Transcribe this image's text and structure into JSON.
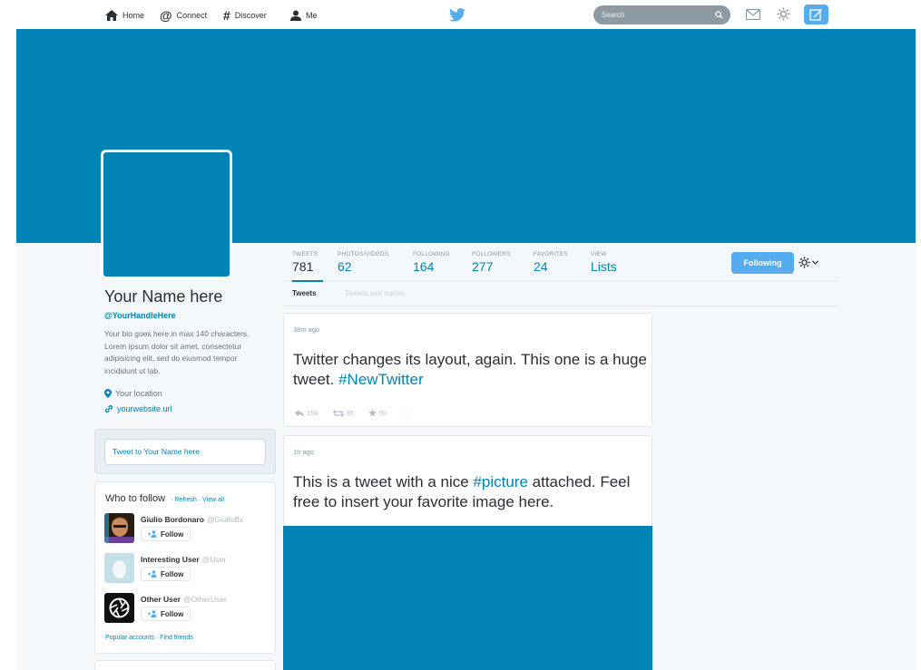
{
  "nav": {
    "home": "Home",
    "connect": "Connect",
    "discover": "Discover",
    "me": "Me",
    "search_placeholder": "Search"
  },
  "profile": {
    "name": "Your Name here",
    "handle": "@YourHandleHere",
    "bio": "Your bio goes here in max 140 characters. Lorem ipsum dolor sit amet, consectetur adipisicing elit, sed do eiusmod tempor incididunt ut lab.",
    "location": "Your location",
    "website": "yourwebsite.url"
  },
  "tweet_box": {
    "placeholder": "Tweet to Your Name here"
  },
  "who_to_follow": {
    "title": "Who to follow",
    "links": "· Refresh · View all",
    "users": [
      {
        "name": "Giulio Bordonaro",
        "handle": "@GiulioBx",
        "follow": "Follow"
      },
      {
        "name": "Interesting User",
        "handle": "@User",
        "follow": "Follow"
      },
      {
        "name": "Other User",
        "handle": "@OtherUser",
        "follow": "Follow"
      }
    ],
    "footer": "Popular accounts · Find friends"
  },
  "stats": [
    {
      "label": "TWEETS",
      "value": "781"
    },
    {
      "label": "PHOTOS/VIDEOS",
      "value": "62"
    },
    {
      "label": "FOLLOWING",
      "value": "164"
    },
    {
      "label": "FOLLOWERS",
      "value": "277"
    },
    {
      "label": "FAVORITES",
      "value": "24"
    },
    {
      "label": "VIEW",
      "value": "Lists"
    }
  ],
  "following_button": "Following",
  "tabs": [
    "Tweets",
    "Tweets and replies"
  ],
  "tweets": [
    {
      "time": "38m ago",
      "text": "Twitter changes its layout, again. This one is a huge tweet.",
      "hashtag": "#NewTwitter",
      "replies": "150",
      "retweets": "35",
      "favorites": "50",
      "more": "···"
    },
    {
      "time": "1h ago",
      "text_before": "This is a tweet with a nice",
      "hashtag": "#picture",
      "text_after": "attached. Feel free to insert your favorite image here."
    }
  ],
  "colors": {
    "header": "#0283b5",
    "accent": "#55acee",
    "link": "#0084b4"
  }
}
